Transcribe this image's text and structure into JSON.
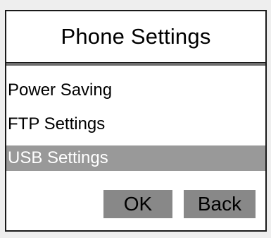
{
  "title": "Phone Settings",
  "menu": {
    "items": [
      {
        "label": "Power Saving",
        "selected": false
      },
      {
        "label": "FTP Settings",
        "selected": false
      },
      {
        "label": "USB Settings",
        "selected": true
      }
    ]
  },
  "buttons": {
    "ok_label": "OK",
    "back_label": "Back"
  },
  "colors": {
    "selected_bg": "#999999",
    "button_bg": "#888888",
    "divider": "#6e6e6e"
  }
}
